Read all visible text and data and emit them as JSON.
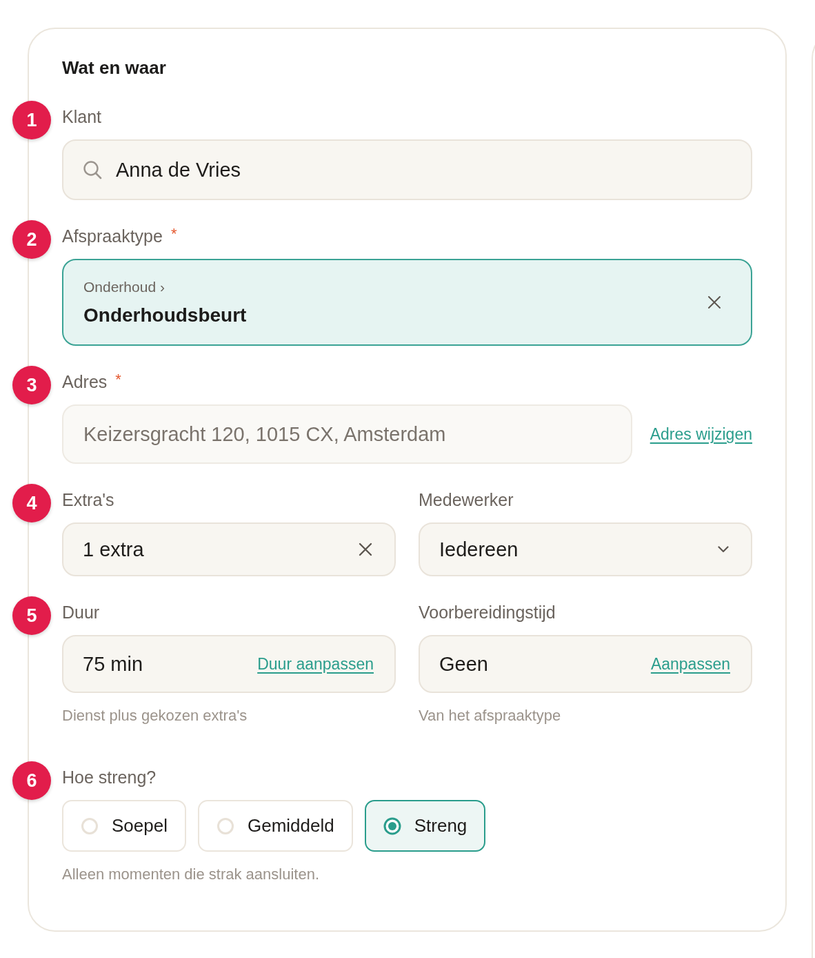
{
  "card": {
    "title": "Wat en waar"
  },
  "steps": [
    {
      "number": "1",
      "fields": [
        {
          "kind": "search",
          "label": "Klant",
          "value": "Anna de Vries"
        }
      ]
    },
    {
      "number": "2",
      "fields": [
        {
          "kind": "selection",
          "label": "Afspraaktype",
          "required_mark": "*",
          "path": "Onderhoud ›",
          "value": "Onderhoudsbeurt"
        }
      ]
    },
    {
      "number": "3",
      "fields": [
        {
          "kind": "address",
          "label": "Adres",
          "required_mark": "*",
          "value": "Keizersgracht 120, 1015 CX, Amsterdam",
          "disabled": true,
          "link": "Adres wijzigen"
        }
      ]
    },
    {
      "number": "4",
      "fields": [
        {
          "kind": "clearable",
          "label": "Extra's",
          "value": "1 extra"
        },
        {
          "kind": "dropdown",
          "label": "Medewerker",
          "value": "Iedereen"
        }
      ]
    },
    {
      "number": "5",
      "fields": [
        {
          "kind": "action",
          "label": "Duur",
          "value": "75 min",
          "link": "Duur aanpassen",
          "hint": "Dienst plus gekozen extra's"
        },
        {
          "kind": "action",
          "label": "Voorbereidingstijd",
          "value": "Geen",
          "link": "Aanpassen",
          "hint": "Van het afspraaktype"
        }
      ]
    },
    {
      "number": "6",
      "fields": [
        {
          "kind": "choice",
          "label": "Hoe streng?",
          "options": [
            {
              "label": "Soepel",
              "selected": false
            },
            {
              "label": "Gemiddeld",
              "selected": false
            },
            {
              "label": "Streng",
              "selected": true
            }
          ],
          "hint": "Alleen momenten die strak aansluiten."
        }
      ]
    }
  ]
}
